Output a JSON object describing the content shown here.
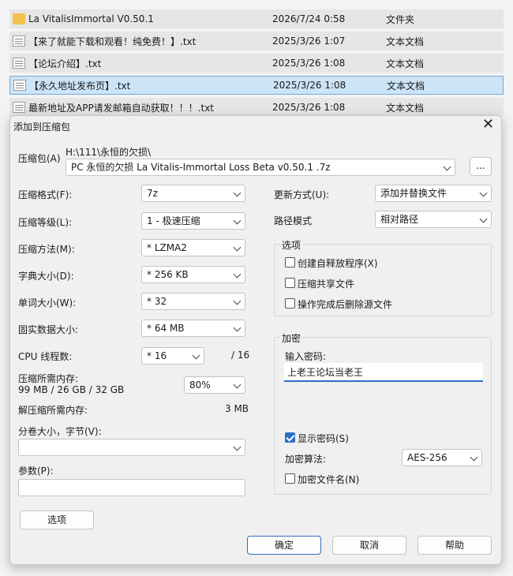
{
  "files": [
    {
      "name": "La VitalisImmortal V0.50.1",
      "date": "2026/7/24 0:58",
      "type": "文件夹",
      "icon": "folder-icon",
      "selected": false
    },
    {
      "name": "【来了就能下载和观看！纯免费！】.txt",
      "date": "2025/3/26 1:07",
      "type": "文本文档",
      "icon": "text-file-icon",
      "selected": false
    },
    {
      "name": "【论坛介绍】.txt",
      "date": "2025/3/26 1:08",
      "type": "文本文档",
      "icon": "text-file-icon",
      "selected": false
    },
    {
      "name": "【永久地址发布页】.txt",
      "date": "2025/3/26 1:08",
      "type": "文本文档",
      "icon": "text-file-icon",
      "selected": true
    },
    {
      "name": "最新地址及APP请发邮箱自动获取！！！.txt",
      "date": "2025/3/26 1:08",
      "type": "文本文档",
      "icon": "text-file-icon",
      "selected": false
    }
  ],
  "dialog": {
    "title": "添加到压缩包",
    "close": "✕",
    "archive_label": "压缩包(A)",
    "archive_path": "H:\\111\\永恒的欠损\\",
    "archive_name": "PC 永恒的欠损 La Vitalis-Immortal Loss Beta  v0.50.1 .7z",
    "browse": "...",
    "format_label": "压缩格式(F):",
    "format_value": "7z",
    "level_label": "压缩等级(L):",
    "level_value": "1 - 极速压缩",
    "method_label": "压缩方法(M):",
    "method_value": "*  LZMA2",
    "dict_label": "字典大小(D):",
    "dict_value": "*  256 KB",
    "word_label": "单词大小(W):",
    "word_value": "*  32",
    "solid_label": "固实数据大小:",
    "solid_value": "*  64 MB",
    "cpu_label": "CPU 线程数:",
    "cpu_value": "*  16",
    "cpu_total": "/ 16",
    "mem_label": "压缩所需内存:",
    "mem_detail": "99 MB / 26 GB / 32 GB",
    "mem_value": "80%",
    "decomp_label": "解压缩所需内存:",
    "decomp_value": "3 MB",
    "split_label": "分卷大小，字节(V):",
    "split_value": "",
    "params_label": "参数(P):",
    "params_value": "",
    "options_button": "选项",
    "update_label": "更新方式(U):",
    "update_value": "添加并替换文件",
    "path_label": "路径模式",
    "path_value": "相对路径",
    "options_group": "选项",
    "sfx_label": "创建自释放程序(X)",
    "sfx_checked": false,
    "shared_label": "压缩共享文件",
    "shared_checked": false,
    "delete_label": "操作完成后删除源文件",
    "delete_checked": false,
    "encrypt_group": "加密",
    "password_label": "输入密码:",
    "password_value": "上老王论坛当老王",
    "show_pw_label": "显示密码(S)",
    "show_pw_checked": true,
    "enc_method_label": "加密算法:",
    "enc_method_value": "AES-256",
    "enc_names_label": "加密文件名(N)",
    "enc_names_checked": false,
    "ok": "确定",
    "cancel": "取消",
    "help": "帮助"
  },
  "colors": {
    "accent": "#2a6fc9",
    "selected_row": "#cce4f7",
    "folder": "#f0c14b"
  }
}
